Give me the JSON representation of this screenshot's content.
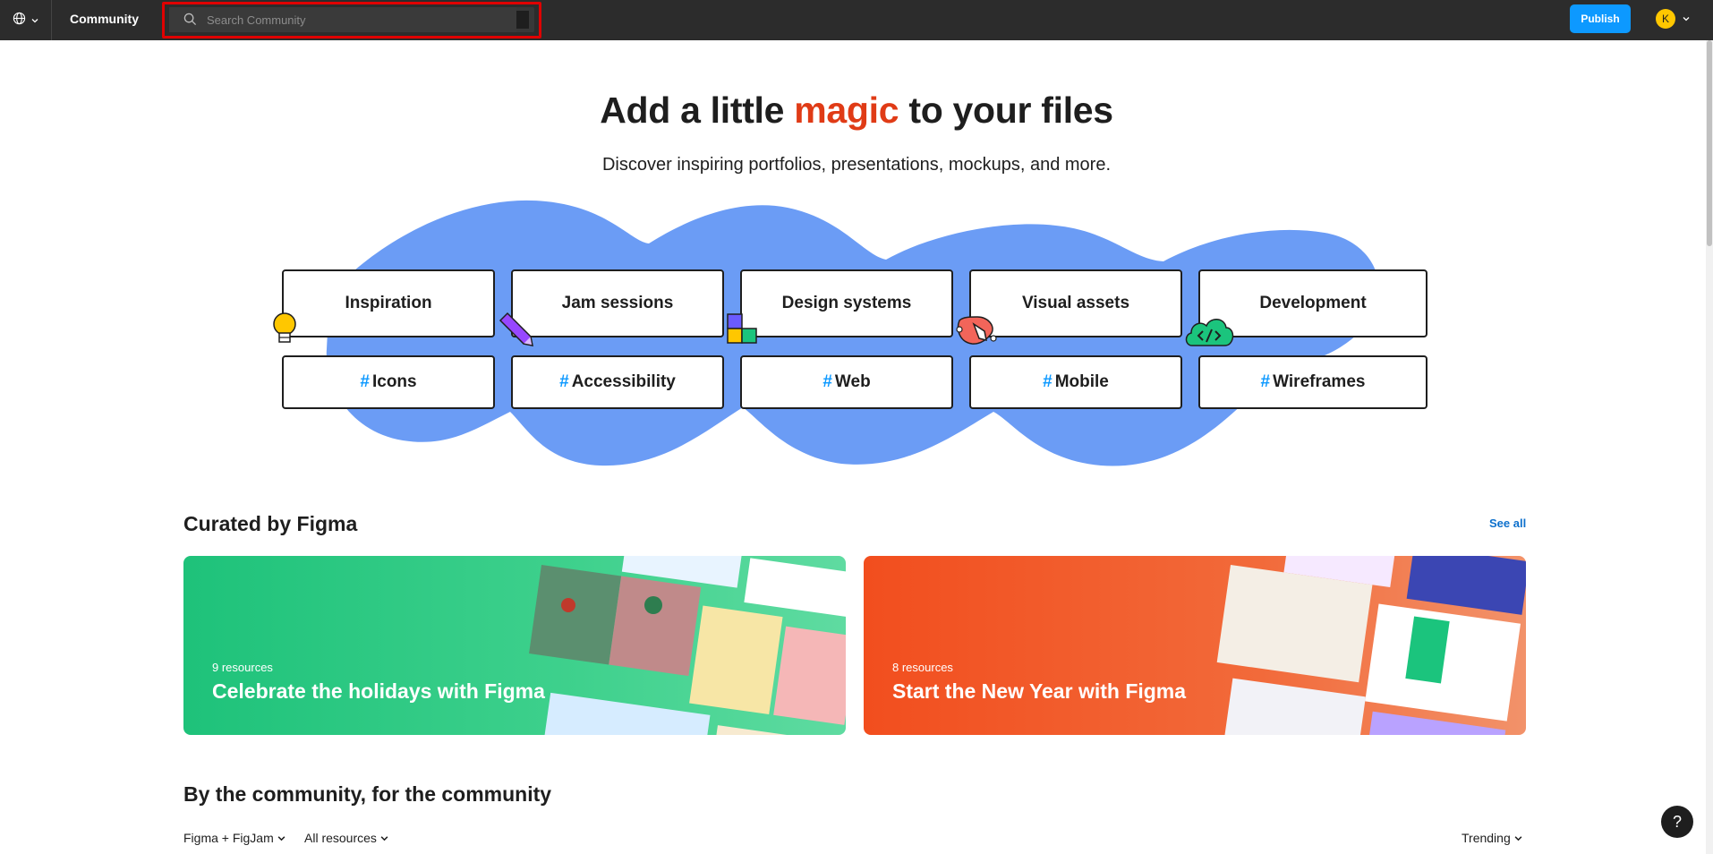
{
  "topbar": {
    "community_label": "Community",
    "search_placeholder": "Search Community",
    "publish_label": "Publish",
    "avatar_initial": "K"
  },
  "hero": {
    "title_before": "Add a little ",
    "title_magic": "magic",
    "title_after": " to your files",
    "subtitle": "Discover inspiring portfolios, presentations, mockups, and more."
  },
  "categories": [
    {
      "label": "Inspiration",
      "icon": "lightbulb-icon"
    },
    {
      "label": "Jam sessions",
      "icon": "pencil-icon"
    },
    {
      "label": "Design systems",
      "icon": "blocks-icon"
    },
    {
      "label": "Visual assets",
      "icon": "pen-tool-icon"
    },
    {
      "label": "Development",
      "icon": "code-cloud-icon"
    }
  ],
  "tags": [
    {
      "hash": "#",
      "label": "Icons"
    },
    {
      "hash": "#",
      "label": "Accessibility"
    },
    {
      "hash": "#",
      "label": "Web"
    },
    {
      "hash": "#",
      "label": "Mobile"
    },
    {
      "hash": "#",
      "label": "Wireframes"
    }
  ],
  "curated": {
    "title": "Curated by Figma",
    "see_all": "See all",
    "banners": [
      {
        "count": "9 resources",
        "title": "Celebrate the holidays with Figma",
        "color": "#1ec27a"
      },
      {
        "count": "8 resources",
        "title": "Start the New Year with Figma",
        "color": "#f24e1e"
      }
    ]
  },
  "community": {
    "title": "By the community, for the community",
    "filter_product": "Figma + FigJam",
    "filter_resources": "All resources",
    "sort": "Trending"
  },
  "help_label": "?",
  "colors": {
    "accent": "#0d99ff",
    "magic": "#e03b16",
    "blob": "#6b9cf5",
    "topbar": "#2c2c2c"
  }
}
